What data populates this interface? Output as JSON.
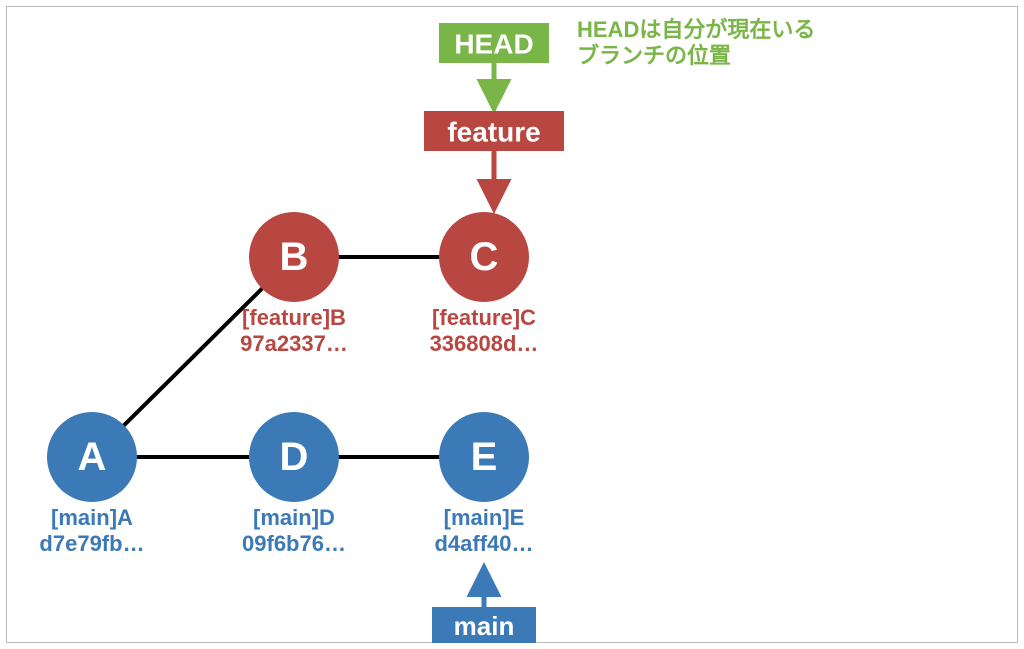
{
  "colors": {
    "blue": "#3b79b7",
    "red": "#b84742",
    "green": "#7ab547"
  },
  "nodes": {
    "A": {
      "letter": "A",
      "branch_label": "[main]A",
      "hash": "d7e79fb…"
    },
    "B": {
      "letter": "B",
      "branch_label": "[feature]B",
      "hash": "97a2337…"
    },
    "C": {
      "letter": "C",
      "branch_label": "[feature]C",
      "hash": "336808d…"
    },
    "D": {
      "letter": "D",
      "branch_label": "[main]D",
      "hash": "09f6b76…"
    },
    "E": {
      "letter": "E",
      "branch_label": "[main]E",
      "hash": "d4aff40…"
    }
  },
  "tags": {
    "head": "HEAD",
    "feature": "feature",
    "main": "main"
  },
  "annotation": {
    "line1": "HEADは自分が現在いる",
    "line2": "ブランチの位置"
  }
}
